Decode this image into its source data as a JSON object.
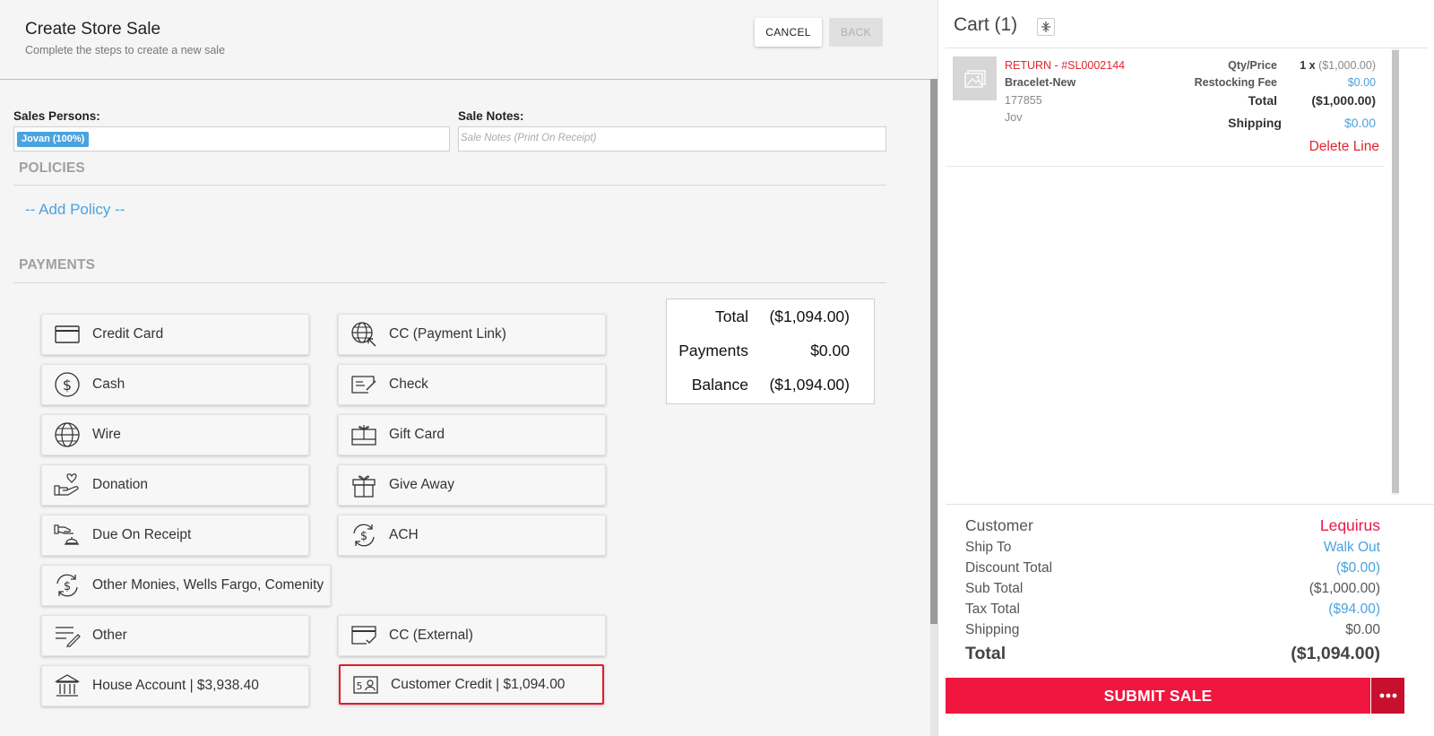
{
  "header": {
    "title": "Create Store Sale",
    "subtitle": "Complete the steps to create a new sale",
    "cancel_label": "CANCEL",
    "back_label": "BACK"
  },
  "form": {
    "sales_persons_label": "Sales Persons:",
    "sales_person_chip": "Jovan (100%)",
    "sale_notes_label": "Sale Notes:",
    "sale_notes_placeholder": "Sale Notes (Print On Receipt)"
  },
  "policies": {
    "title": "POLICIES",
    "add_label": "-- Add Policy --"
  },
  "payments": {
    "title": "PAYMENTS",
    "methods": [
      {
        "label": "Credit Card",
        "icon": "credit-card-icon"
      },
      {
        "label": "CC (Payment Link)",
        "icon": "globe-link-icon"
      },
      {
        "label": "Cash",
        "icon": "dollar-coin-icon"
      },
      {
        "label": "Check",
        "icon": "check-icon"
      },
      {
        "label": "Wire",
        "icon": "globe-icon"
      },
      {
        "label": "Gift Card",
        "icon": "gift-card-icon"
      },
      {
        "label": "Donation",
        "icon": "donation-icon"
      },
      {
        "label": "Give Away",
        "icon": "gift-box-icon"
      },
      {
        "label": "Due On Receipt",
        "icon": "hand-bell-icon"
      },
      {
        "label": "ACH",
        "icon": "dollar-cycle-icon"
      },
      {
        "label": "Other Monies, Wells Fargo, Comenity",
        "icon": "dollar-cycle-icon"
      },
      {
        "label": "Other",
        "icon": "list-pencil-icon"
      },
      {
        "label": "CC (External)",
        "icon": "card-check-icon"
      },
      {
        "label": "House Account | $3,938.40",
        "icon": "bank-icon"
      },
      {
        "label": "Customer Credit | $1,094.00",
        "icon": "id-card-icon"
      }
    ],
    "selected": "Customer Credit | $1,094.00"
  },
  "totals": {
    "total_label": "Total",
    "total_value": "($1,094.00)",
    "payments_label": "Payments",
    "payments_value": "$0.00",
    "balance_label": "Balance",
    "balance_value": "($1,094.00)"
  },
  "cart": {
    "title": "Cart (1)",
    "item": {
      "ref": "RETURN - #SL0002144",
      "name": "Bracelet-New",
      "sku": "177855",
      "rep": "Jov",
      "qty_price_label": "Qty/Price",
      "qty": "1 x",
      "price": "($1,000.00)",
      "restocking_label": "Restocking Fee",
      "restocking_value": "$0.00",
      "total_label": "Total",
      "total_value": "($1,000.00)",
      "shipping_label": "Shipping",
      "shipping_value": "$0.00",
      "delete_label": "Delete Line"
    },
    "summary": {
      "customer_label": "Customer",
      "customer_value": "Lequirus",
      "ship_to_label": "Ship To",
      "ship_to_value": "Walk Out",
      "discount_label": "Discount Total",
      "discount_value": "($0.00)",
      "subtotal_label": "Sub Total",
      "subtotal_value": "($1,000.00)",
      "tax_label": "Tax Total",
      "tax_value": "($94.00)",
      "shipping_label": "Shipping",
      "shipping_value": "$0.00",
      "total_label": "Total",
      "total_value": "($1,094.00)"
    },
    "submit_label": "SUBMIT SALE"
  },
  "colors": {
    "accent_blue": "#4aa3df",
    "alert_red": "#e0262f",
    "submit_red": "#f0163f",
    "customer_red": "#e8174a"
  }
}
